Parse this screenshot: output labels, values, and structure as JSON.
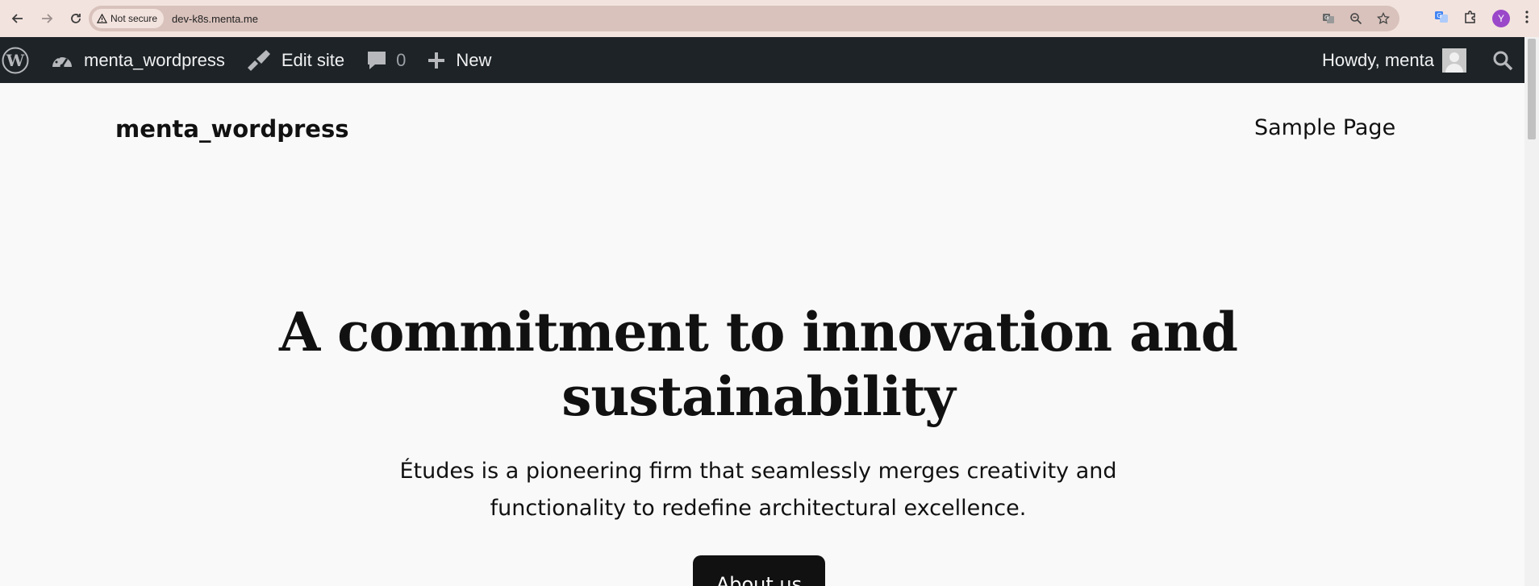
{
  "browser": {
    "security_label": "Not secure",
    "url": "dev-k8s.menta.me",
    "profile_initial": "Y"
  },
  "admin_bar": {
    "site_name": "menta_wordpress",
    "edit_site_label": "Edit site",
    "comments_count": "0",
    "new_label": "New",
    "howdy_label": "Howdy, menta"
  },
  "site": {
    "title": "menta_wordpress",
    "nav_items": [
      "Sample Page"
    ]
  },
  "hero": {
    "heading": "A commitment to innovation and sustainability",
    "text": "Études is a pioneering firm that seamlessly merges creativity and functionality to redefine architectural excellence.",
    "button_label": "About us"
  },
  "colors": {
    "admin_bar_bg": "#1d2327",
    "browser_bar_bg": "#f3e3de",
    "page_bg": "#f9f9f9",
    "button_bg": "#111111"
  }
}
